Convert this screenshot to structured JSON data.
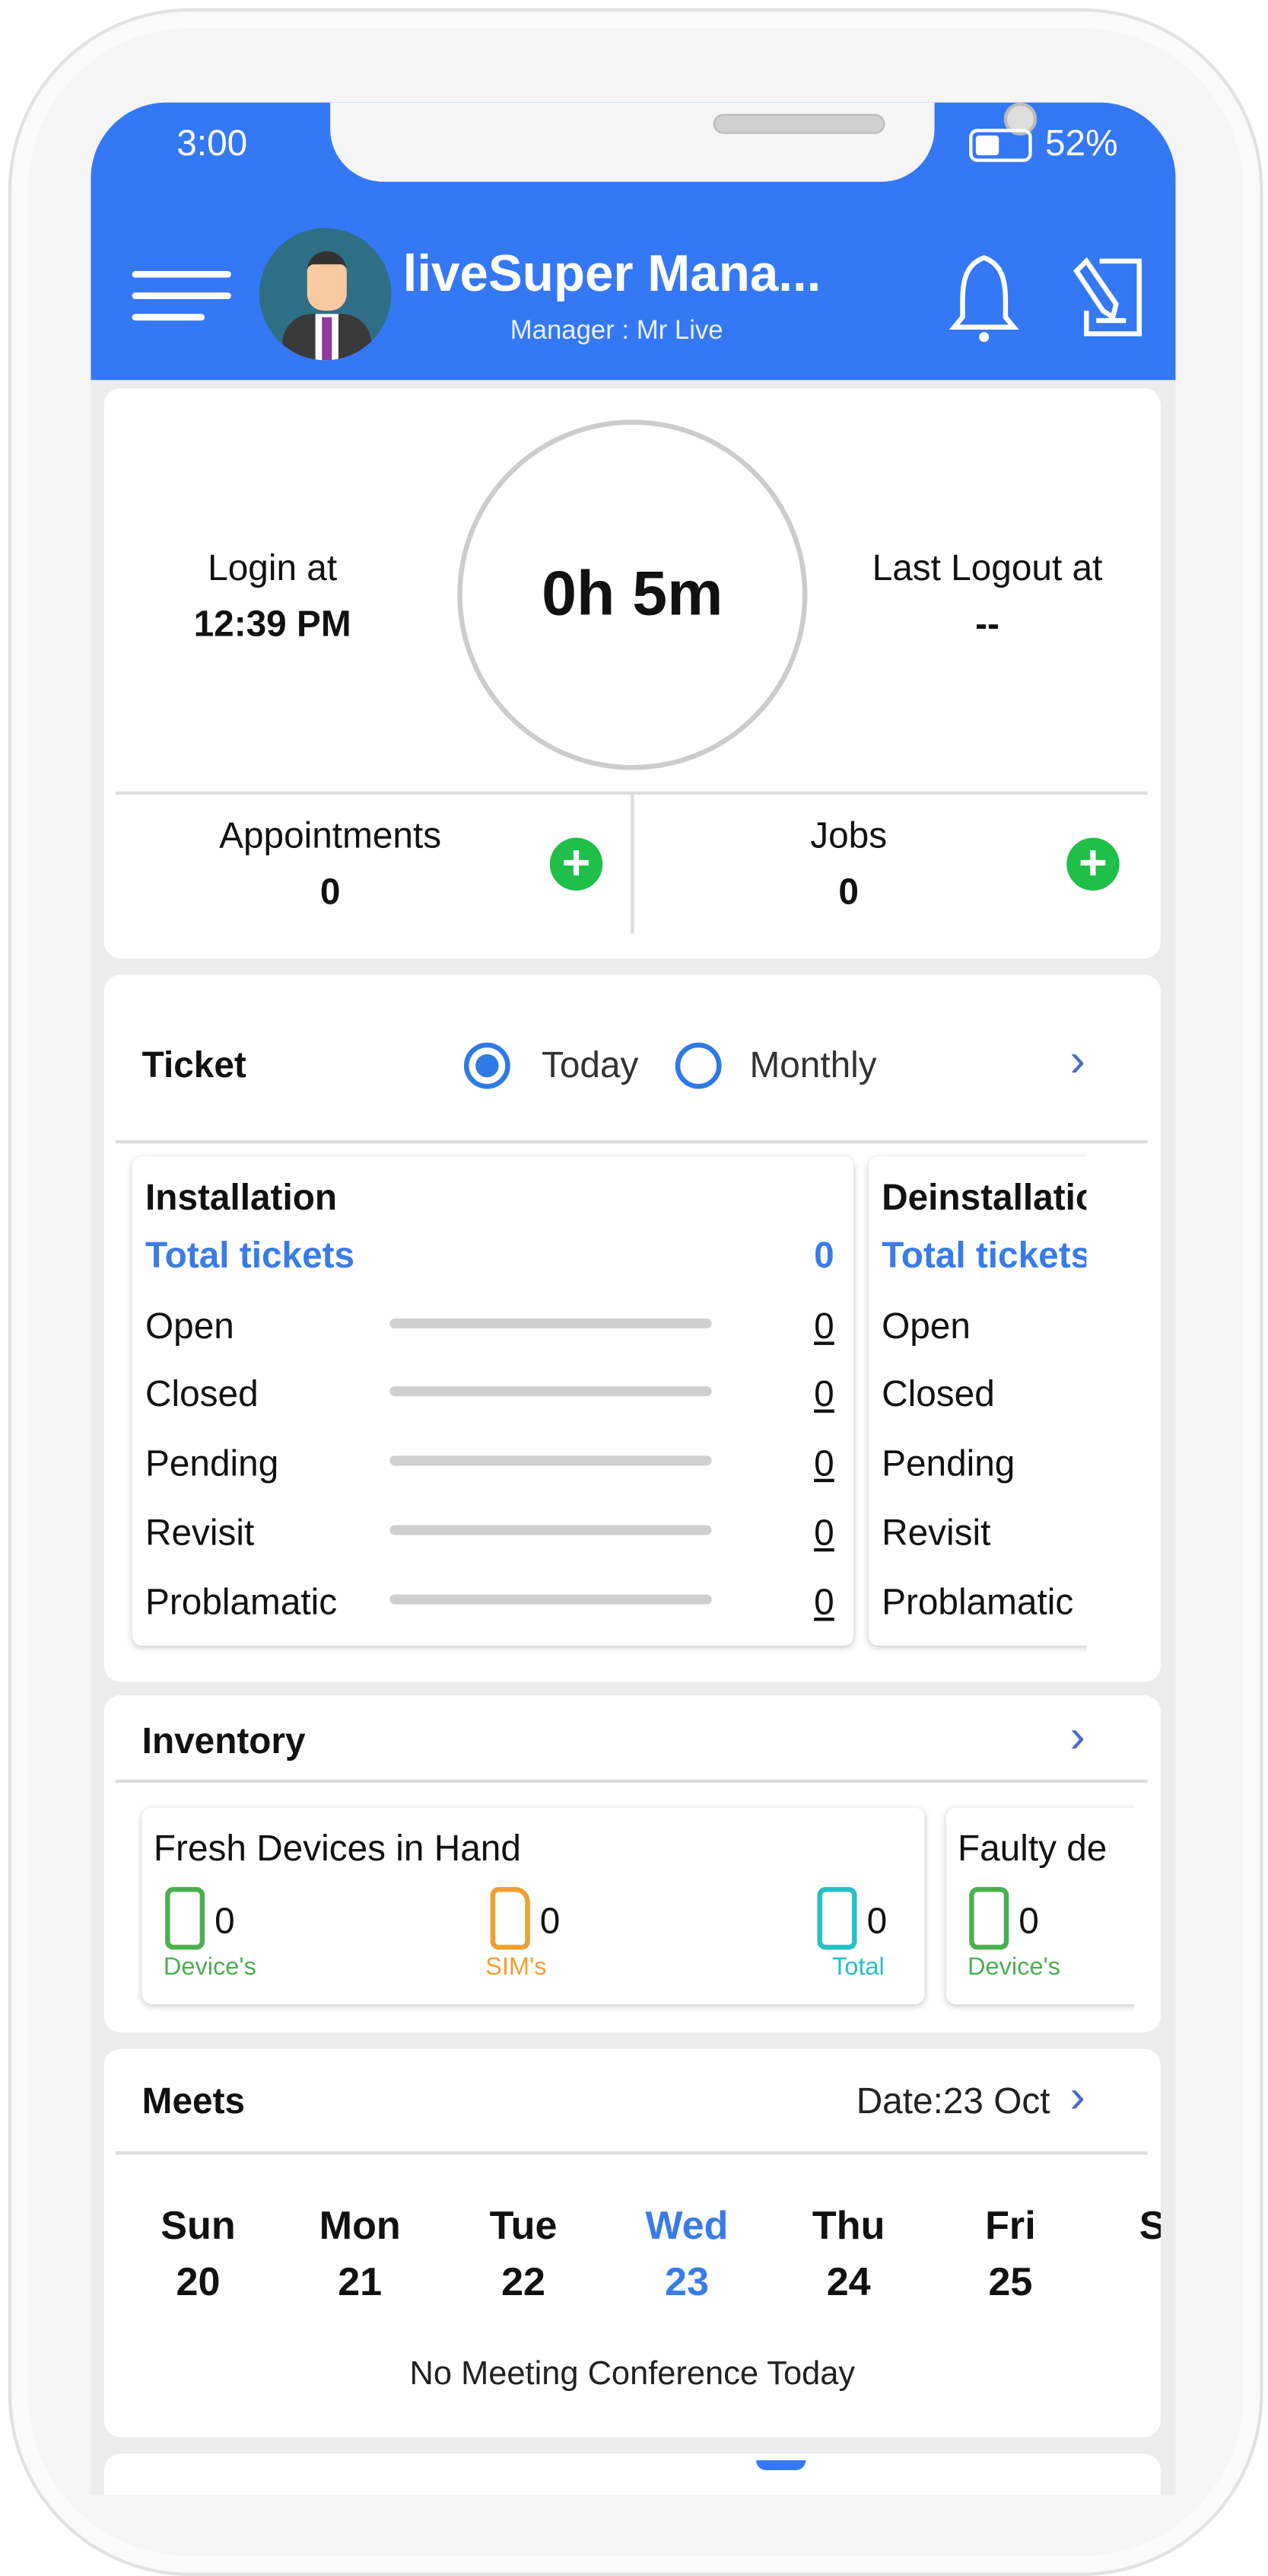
{
  "status_bar": {
    "time": "3:00",
    "battery": "52%",
    "battery_level_percent": 52
  },
  "header": {
    "title": "liveSuper Mana...",
    "subtitle": "Manager : Mr Live",
    "accent": "#3478f6",
    "icons": [
      "menu-icon",
      "avatar",
      "bell-icon",
      "edit-icon"
    ]
  },
  "attendance": {
    "login_label": "Login at",
    "login_time": "12:39 PM",
    "duration": "0h 5m",
    "logout_label": "Last Logout at",
    "logout_time": "--",
    "appointments_label": "Appointments",
    "appointments_count": "0",
    "jobs_label": "Jobs",
    "jobs_count": "0"
  },
  "ticket": {
    "title": "Ticket",
    "options": [
      {
        "label": "Today",
        "selected": true
      },
      {
        "label": "Monthly",
        "selected": false
      }
    ],
    "cards": [
      {
        "title": "Installation",
        "total_label": "Total tickets",
        "total": "0",
        "rows": [
          {
            "label": "Open",
            "value": "0"
          },
          {
            "label": "Closed",
            "value": "0"
          },
          {
            "label": "Pending",
            "value": "0"
          },
          {
            "label": "Revisit",
            "value": "0"
          },
          {
            "label": "Problamatic",
            "value": "0"
          }
        ]
      },
      {
        "title": "Deinstallation",
        "total_label": "Total tickets",
        "rows": [
          {
            "label": "Open"
          },
          {
            "label": "Closed"
          },
          {
            "label": "Pending"
          },
          {
            "label": "Revisit"
          },
          {
            "label": "Problamatic"
          }
        ]
      }
    ]
  },
  "inventory": {
    "title": "Inventory",
    "cards": [
      {
        "title": "Fresh Devices in Hand",
        "items": [
          {
            "label": "Device's",
            "value": "0",
            "color": "#4caf50",
            "icon": "phone-icon"
          },
          {
            "label": "SIM's",
            "value": "0",
            "color": "#f0a030",
            "icon": "sim-icon"
          },
          {
            "label": "Total",
            "value": "0",
            "color": "#26c0c8",
            "icon": "devices-icon"
          }
        ]
      },
      {
        "title": "Faulty de",
        "items": [
          {
            "label": "Device's",
            "value": "0",
            "color": "#4caf50",
            "icon": "phone-icon"
          }
        ]
      }
    ]
  },
  "meets": {
    "title": "Meets",
    "date": "Date:23 Oct",
    "days": [
      {
        "name": "Sun",
        "num": "20"
      },
      {
        "name": "Mon",
        "num": "21"
      },
      {
        "name": "Tue",
        "num": "22"
      },
      {
        "name": "Wed",
        "num": "23",
        "selected": true
      },
      {
        "name": "Thu",
        "num": "24"
      },
      {
        "name": "Fri",
        "num": "25"
      },
      {
        "name": "S",
        "num": ""
      }
    ],
    "empty_text": "No Meeting Conference Today"
  }
}
